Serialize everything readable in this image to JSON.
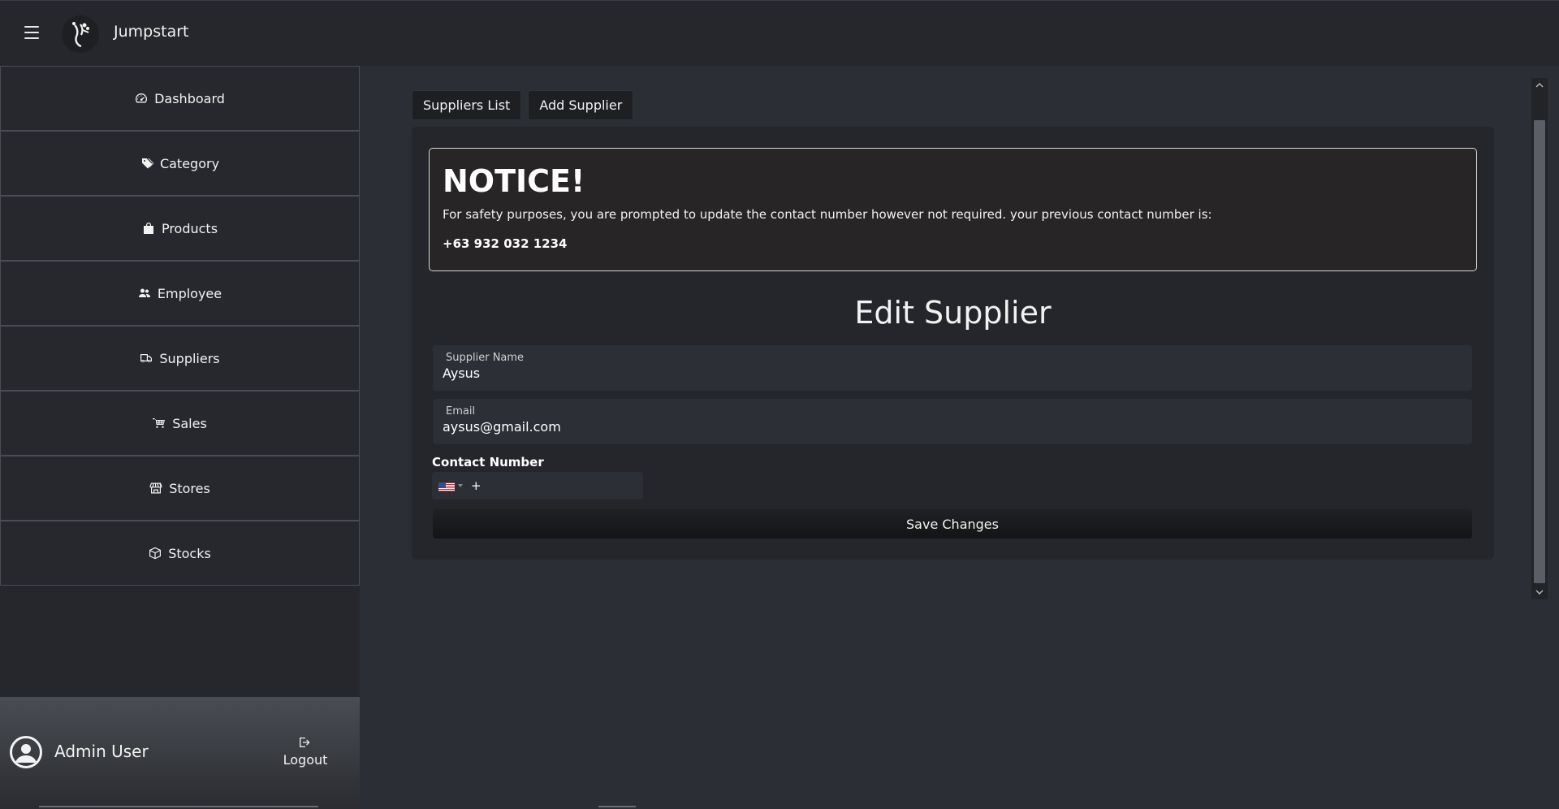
{
  "header": {
    "app_title": "Jumpstart",
    "menu_icon": "hamburger-icon",
    "logo_icon": "jumpstart-logo"
  },
  "sidebar": {
    "items": [
      {
        "label": "Dashboard",
        "icon": "dashboard-gauge-icon"
      },
      {
        "label": "Category",
        "icon": "tags-icon"
      },
      {
        "label": "Products",
        "icon": "shopping-bag-icon"
      },
      {
        "label": "Employee",
        "icon": "people-icon"
      },
      {
        "label": "Suppliers",
        "icon": "truck-icon"
      },
      {
        "label": "Sales",
        "icon": "cart-icon"
      },
      {
        "label": "Stores",
        "icon": "shop-icon"
      },
      {
        "label": "Stocks",
        "icon": "box-icon"
      }
    ],
    "user": {
      "name": "Admin User",
      "avatar_icon": "user-circle-icon"
    },
    "logout_label": "Logout"
  },
  "tabs": {
    "suppliers_list": "Suppliers List",
    "add_supplier": "Add Supplier"
  },
  "notice": {
    "title": "NOTICE!",
    "message": "For safety purposes, you are prompted to update the contact number however not required. your previous contact number is:",
    "previous_number": "+63 932 032 1234"
  },
  "form": {
    "title": "Edit Supplier",
    "supplier_name": {
      "label": "Supplier Name",
      "value": "Aysus"
    },
    "email": {
      "label": "Email",
      "value": "aysus@gmail.com"
    },
    "contact": {
      "label": "Contact Number",
      "value": "+",
      "country_icon": "us-flag-icon"
    },
    "save_label": "Save Changes"
  },
  "colors": {
    "background": "#2b2e34",
    "sidebar": "#25272c",
    "card": "#24262b",
    "notice_border": "#d8d8d8",
    "text": "#ffffff"
  }
}
